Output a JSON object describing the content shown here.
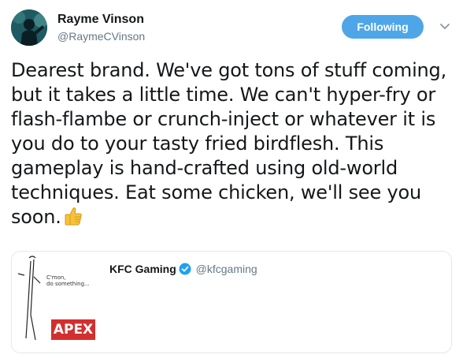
{
  "user": {
    "display_name": "Rayme Vinson",
    "handle": "@RaymeCVinson",
    "avatar_icon": "avatar-silhouette"
  },
  "actions": {
    "follow_label": "Following",
    "menu_icon": "chevron-down-icon"
  },
  "tweet": {
    "text": "Dearest brand. We've got tons of stuff coming, but it takes a little time. We can't hyper-fry or flash-flambe or crunch-inject or whatever it is you do to your tasty fried birdflesh. This gameplay is hand-crafted using old-world techniques. Eat some chicken, we'll see you soon.",
    "emoji": "thumbs-up-icon"
  },
  "quote": {
    "display_name": "KFC Gaming",
    "handle": "@kfcgaming",
    "verified": true,
    "thumbnail_caption": "C'mon,\ndo something...",
    "thumbnail_logo": "APEX"
  },
  "colors": {
    "accent": "#4ea6e8",
    "text": "#14171a",
    "muted": "#657786",
    "border": "#e1e8ed",
    "apex_red": "#d32f2f"
  }
}
